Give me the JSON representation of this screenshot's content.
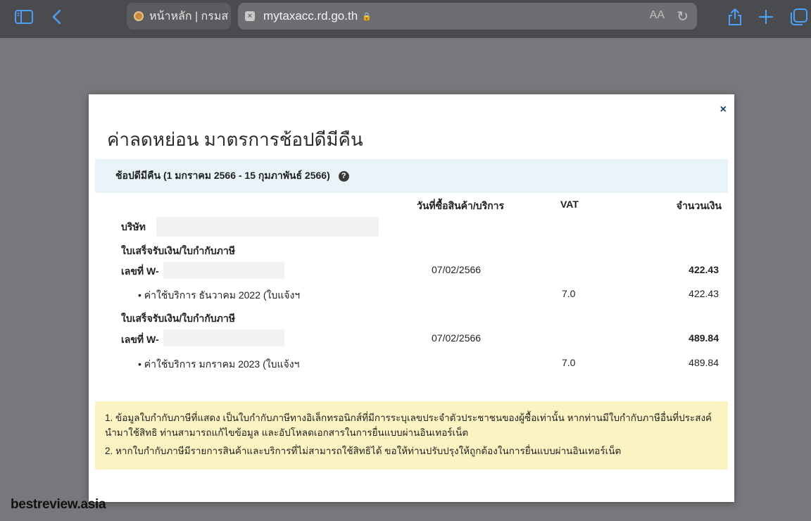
{
  "browser": {
    "inactive_tab_title": "หน้าหลัก | กรมส",
    "active_tab_url": "mytaxacc.rd.go.th",
    "lock_glyph": "🔒",
    "text_size_label": "AA",
    "reload_glyph": "↻",
    "tab_close_glyph": "×",
    "accent_color": "#4d9ef7"
  },
  "modal": {
    "close_glyph": "×",
    "title": "ค่าลดหย่อน มาตรการช้อปดีมีคืน",
    "section_header": "ช้อปดีมีคืน (1 มกราคม 2566 - 15 กุมภาพันธ์ 2566)",
    "help_glyph": "?",
    "columns": {
      "date": "วันที่ซื้อสินค้า/บริการ",
      "vat": "VAT",
      "amount": "จำนวนเงิน"
    },
    "company_label": "บริษัท",
    "receipts": [
      {
        "doc_type": "ใบเสร็จรับเงิน/ใบกำกับภาษี",
        "doc_no": "เลขที่ W-",
        "date": "07/02/2566",
        "total": "422.43",
        "item_label": "• ค่าใช้บริการ ธันวาคม 2022 (ใบแจ้งฯ",
        "item_vat": "7.0",
        "item_amount": "422.43"
      },
      {
        "doc_type": "ใบเสร็จรับเงิน/ใบกำกับภาษี",
        "doc_no": "เลขที่ W-",
        "date": "07/02/2566",
        "total": "489.84",
        "item_label": "• ค่าใช้บริการ มกราคม 2023 (ใบแจ้งฯ",
        "item_vat": "7.0",
        "item_amount": "489.84"
      }
    ],
    "notes": [
      "1. ข้อมูลใบกำกับภาษีที่แสดง เป็นใบกำกับภาษีทางอิเล็กทรอนิกส์ที่มีการระบุเลขประจำตัวประชาชนของผู้ซื้อเท่านั้น หากท่านมีใบกำกับภาษีอื่นที่ประสงค์นำมาใช้สิทธิ ท่านสามารถแก้ไขข้อมูล และอัปโหลดเอกสารในการยื่นแบบผ่านอินเทอร์เน็ต",
      "2. หากใบกำกับภาษีมีรายการสินค้าและบริการที่ไม่สามารถใช้สิทธิได้ ขอให้ท่านปรับปรุงให้ถูกต้องในการยื่นแบบผ่านอินเทอร์เน็ต"
    ]
  },
  "watermark": "bestreview.asia"
}
